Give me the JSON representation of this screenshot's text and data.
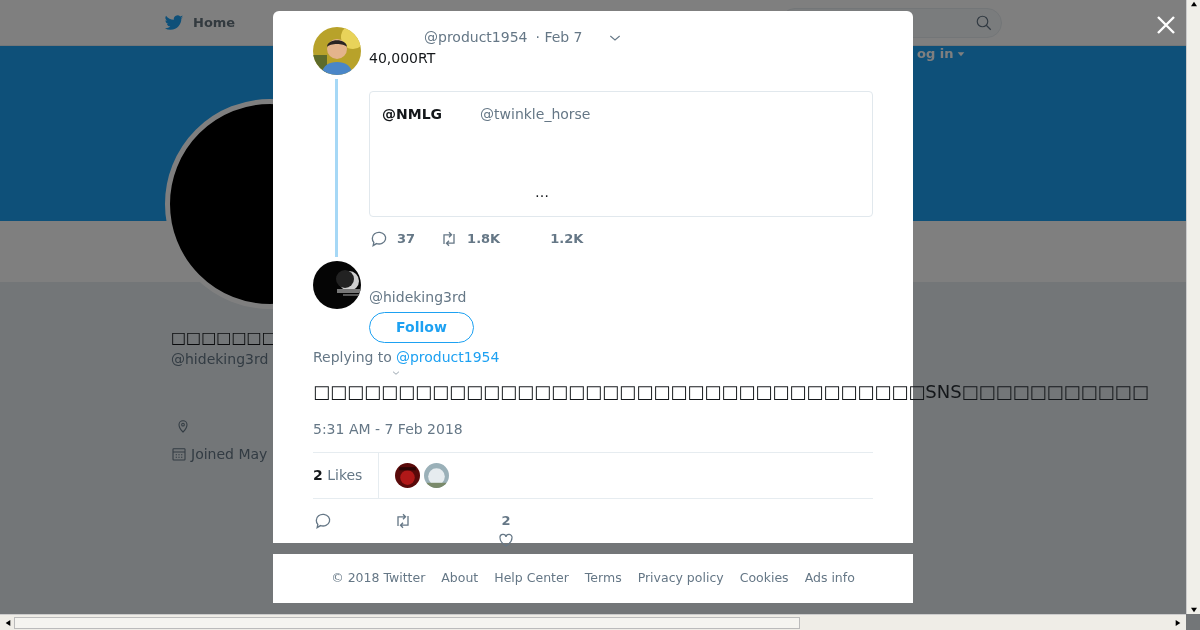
{
  "nav": {
    "home": "Home",
    "login": "og in"
  },
  "profile": {
    "name": "□□□□□□□",
    "handle": "@hideking3rd",
    "joined": "Joined May"
  },
  "tweet": {
    "handle": "@product1954",
    "date": "· Feb 7",
    "text": "40,000RT",
    "quote": {
      "name": "@NMLG",
      "handle": "@twinkle_horse",
      "text": "…"
    },
    "replies": "37",
    "retweets": "1.8K",
    "likes": "1.2K"
  },
  "reply": {
    "handle": "@hideking3rd",
    "follow": "Follow",
    "replying_to": "Replying to",
    "replying_handle": "@product1954",
    "text": "□□□□□□□□□□□□□□□□□□□□□□□□□□□□□□□□□□□□SNS□□□□□□□□□□□",
    "time": "5:31 AM - 7 Feb 2018",
    "likes_count": "2",
    "likes_label": "Likes",
    "like_count": "2"
  },
  "footer": [
    "© 2018 Twitter",
    "About",
    "Help Center",
    "Terms",
    "Privacy policy",
    "Cookies",
    "Ads info"
  ]
}
